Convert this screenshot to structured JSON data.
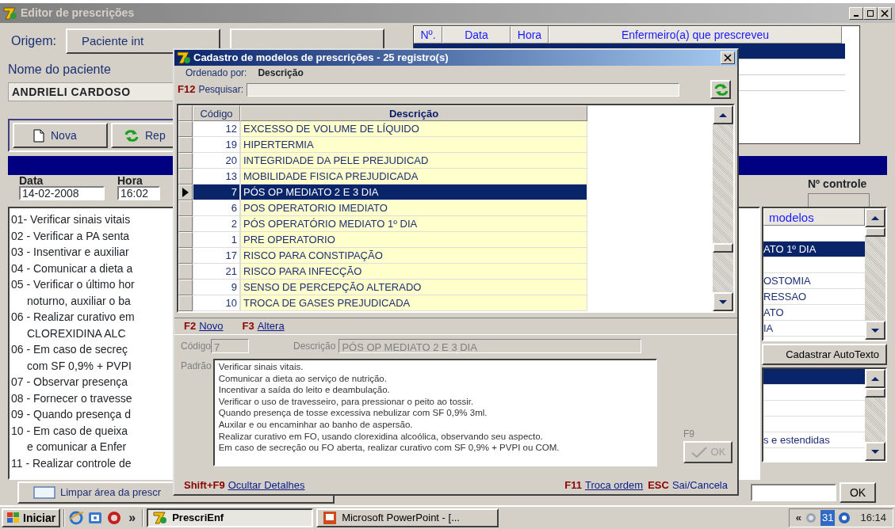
{
  "main_window": {
    "title": "Editor de prescrições",
    "origin_label": "Origem:",
    "origin_button": "Paciente int",
    "patient_label": "Nome do paciente",
    "patient_name": "ANDRIELI CARDOSO",
    "toolbar": [
      {
        "label": "Nova"
      },
      {
        "label": "Rep"
      }
    ],
    "prescriptions_table": {
      "columns": [
        "Nº.",
        "Data",
        "Hora",
        "Enfermeiro(a) que prescreveu"
      ],
      "rows": [
        {
          "selected": true
        },
        {
          "selected": false
        },
        {
          "selected": false
        }
      ]
    },
    "date_label": "Data",
    "date": "14-02-2008",
    "time_label": "Hora",
    "time": "16:02",
    "control_label": "Nº controle",
    "prescription_lines": [
      {
        "kind": "item",
        "text": "01- Verificar sinais vitais"
      },
      {
        "kind": "item",
        "text": "02 - Verificar a PA senta"
      },
      {
        "kind": "item",
        "text": "03 - Insentivar e auxiliar"
      },
      {
        "kind": "item",
        "text": "04 - Comunicar a dieta a"
      },
      {
        "kind": "item",
        "text": "05 - Verificar o último hor"
      },
      {
        "kind": "continuation",
        "text": "noturno, auxiliar o ba"
      },
      {
        "kind": "item",
        "text": "06 - Realizar curativo em"
      },
      {
        "kind": "continuation",
        "text": "CLOREXIDINA ALC"
      },
      {
        "kind": "item",
        "text": "06 - Em caso de secreç"
      },
      {
        "kind": "continuation",
        "text": "com SF 0,9% + PVPI"
      },
      {
        "kind": "item",
        "text": "07 - Observar presença"
      },
      {
        "kind": "item",
        "text": "08 - Fornecer o travesse"
      },
      {
        "kind": "item",
        "text": "09 - Quando presença d"
      },
      {
        "kind": "item",
        "text": "10 - Em caso de queixa"
      },
      {
        "kind": "continuation",
        "text": "e comunicar a Enfer"
      },
      {
        "kind": "item",
        "text": "11 - Realizar controle de"
      }
    ],
    "models_list": {
      "header": "modelos",
      "rows": [
        {
          "selected": false
        },
        {
          "text": "ATO 1º DIA",
          "selected": true
        },
        {
          "selected": false
        },
        {
          "text": "OSTOMIA",
          "selected": false
        },
        {
          "text": "RESSAO",
          "selected": false
        },
        {
          "text": "ATO",
          "selected": false
        },
        {
          "text": "IA",
          "selected": false
        }
      ]
    },
    "autotext_button": "Cadastrar AutoTexto",
    "autotext_list": {
      "rows": [
        {
          "selected": true
        },
        {
          "selected": false
        },
        {
          "selected": false
        },
        {
          "selected": false
        },
        {
          "text": "s e estendidas",
          "selected": false
        }
      ]
    },
    "ok_button": "OK",
    "clear_button": "Limpar área da prescr"
  },
  "dialog": {
    "title": "Cadastro de modelos de prescrições - 25 registro(s)",
    "sort_label": "Ordenado por:",
    "sort_value": "Descrição",
    "search_key": "F12",
    "search_label": "Pesquisar:",
    "columns": [
      "Código",
      "Descrição"
    ],
    "rows": [
      {
        "code": "12",
        "description": "EXCESSO DE VOLUME DE LÍQUIDO",
        "selected": false
      },
      {
        "code": "19",
        "description": "HIPERTERMIA",
        "selected": false
      },
      {
        "code": "20",
        "description": "INTEGRIDADE DA PELE PREJUDICAD",
        "selected": false
      },
      {
        "code": "13",
        "description": "MOBILIDADE FISICA PREJUDICADA",
        "selected": false
      },
      {
        "code": "7",
        "description": "PÓS OP MEDIATO 2 E 3 DIA",
        "selected": true
      },
      {
        "code": "6",
        "description": "POS OPERATORIO IMEDIATO",
        "selected": false
      },
      {
        "code": "2",
        "description": "PÓS OPERATÓRIO MEDIATO 1º DIA",
        "selected": false
      },
      {
        "code": "1",
        "description": "PRE OPERATORIO",
        "selected": false
      },
      {
        "code": "17",
        "description": "RISCO PARA CONSTIPAÇÃO",
        "selected": false
      },
      {
        "code": "21",
        "description": "RISCO PARA INFECÇÃO",
        "selected": false
      },
      {
        "code": "9",
        "description": "SENSO DE PERCEPÇÃO ALTERADO",
        "selected": false
      },
      {
        "code": "10",
        "description": "TROCA DE GASES PREJUDICADA",
        "selected": false
      }
    ],
    "shortcuts_top": [
      {
        "key": "F2",
        "label": "Novo",
        "kind": "link"
      },
      {
        "key": "F3",
        "label": "Altera",
        "kind": "link"
      }
    ],
    "detail": {
      "code_label": "Código",
      "code": "7",
      "description_label": "Descrição",
      "description": "PÓS OP MEDIATO 2 E 3 DIA",
      "default_label": "Padrão",
      "default_lines": [
        "Verificar sinais vitais.",
        "Comunicar a dieta ao serviço de nutrição.",
        "Incentivar a saída do leito e deambulação.",
        "Verificar o uso de travesseiro, para pressionar o peito ao tossir.",
        "Quando presença de tosse excessiva nebulizar com SF 0,9% 3ml.",
        "Auxilar e ou encaminhar ao banho de aspersão.",
        "Realizar curativo em FO, usando clorexidina alcoólica, observando seu aspecto.",
        "Em caso de secreção ou FO aberta, realizar curativo com SF 0,9% + PVPI ou COM."
      ]
    },
    "ok_key": "F9",
    "ok_button": {
      "label": "OK",
      "disabled": true
    },
    "shortcuts_bottom": [
      {
        "key": "Shift+F9",
        "label": "Ocultar Detalhes",
        "kind": "link"
      },
      {
        "key": "F11",
        "label": "Troca ordem",
        "kind": "link"
      },
      {
        "key": "ESC",
        "label": "Sai/Cancela",
        "kind": "text"
      }
    ]
  },
  "taskbar": {
    "start": "Iniciar",
    "more": "»",
    "tasks": [
      {
        "label": "PrescriEnf",
        "selected": true
      },
      {
        "label": "Microsoft PowerPoint - [...",
        "selected": false
      }
    ],
    "tray_expand": "«",
    "tray_badge": "31",
    "clock": "16:14"
  }
}
